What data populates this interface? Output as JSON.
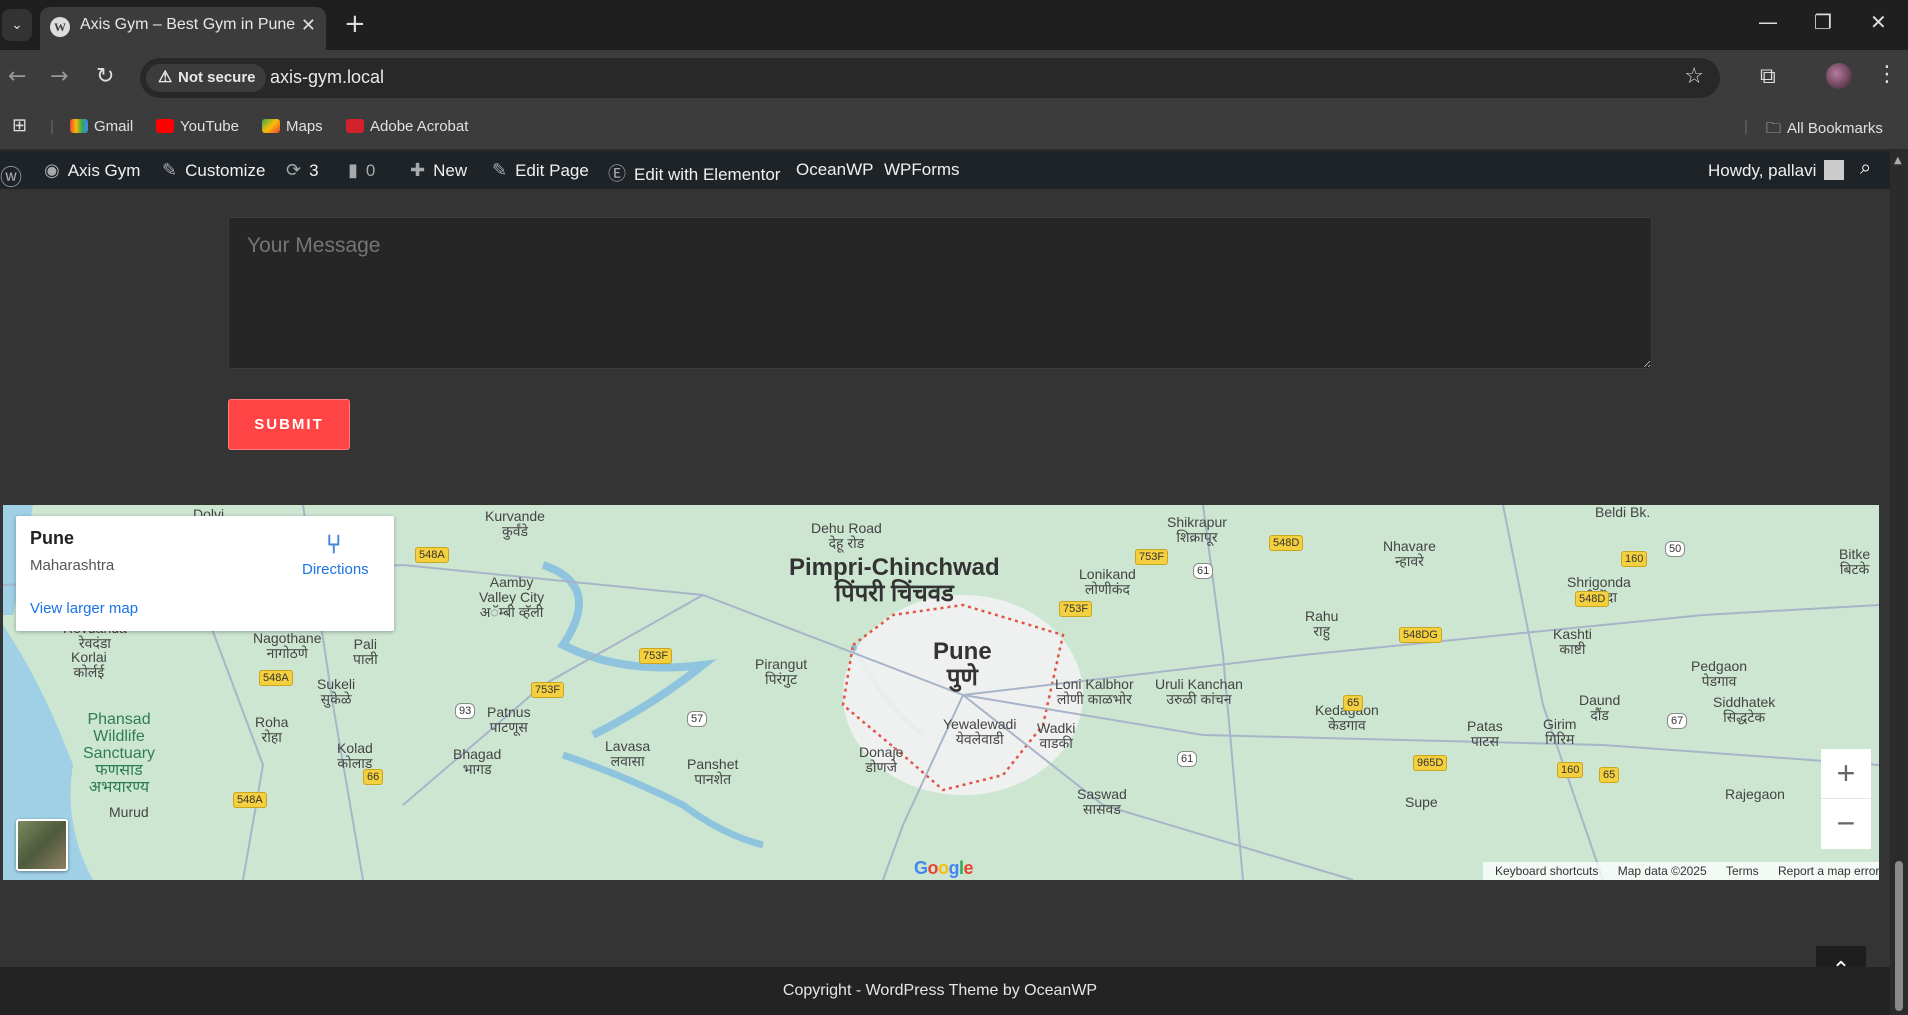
{
  "browser": {
    "tab_title": "Axis Gym – Best Gym in Pune",
    "security_label": "Not secure",
    "url": "axis-gym.local",
    "bookmarks": [
      "Gmail",
      "YouTube",
      "Maps",
      "Adobe Acrobat"
    ],
    "all_bookmarks": "All Bookmarks"
  },
  "adminbar": {
    "site_name": "Axis Gym",
    "customize": "Customize",
    "updates": "3",
    "comments": "0",
    "new": "New",
    "edit_page": "Edit Page",
    "edit_elementor": "Edit with Elementor",
    "oceanwp": "OceanWP",
    "wpforms": "WPForms",
    "howdy": "Howdy, pallavi"
  },
  "form": {
    "message_placeholder": "Your Message",
    "submit_label": "SUBMIT"
  },
  "map": {
    "place_name": "Pune",
    "place_region": "Maharashtra",
    "directions": "Directions",
    "view_larger": "View larger map",
    "labels": [
      "Dolvi",
      "Kurvande\nकुर्वंडे",
      "Dehu Road\nदेहू रोड",
      "Shikrapur\nशिक्रापूर",
      "Nhavare\nन्हावरे",
      "Beldi Bk.",
      "Aamby\nValley City\nअॅम्बी व्हॅली",
      "Lonikand\nलोणीकंद",
      "Rahu\nराहु",
      "Shrigonda\nश्रीगोंदा",
      "Bitke\nबिटके",
      "Revdanda\nरेवदंडा",
      "Korlai\nकोर्लई",
      "Nagothane\nनागोठणे",
      "Pali\nपाली",
      "Kashti\nकाष्टी",
      "Pirangut\nपिरंगुट",
      "Loni Kalbhor\nलोणी काळभोर",
      "Uruli Kanchan\nउरुळी कांचन",
      "Pedgaon\nपेडगाव",
      "Sukeli\nसुकेळे",
      "Patnus\nपाटणूस",
      "Daund\nदौंड",
      "Siddhatek\nसिद्धटेक",
      "Phansad\nWildlife\nSanctuary\nफणसाड\nअभयारण्य",
      "Roha\nरोहा",
      "Kedagaon\nकेडगाव",
      "Patas\nपाटस",
      "Girim\nगिरिम",
      "Yewalewadi\nयेवलेवाडी",
      "Wadki\nवाडकी",
      "Lavasa\nलवासा",
      "Kolad\nकोलाड",
      "Bhagad\nभागड",
      "Panshet\nपानशेत",
      "Donaje\nडोणजे",
      "Saswad\nसासवड",
      "Supe",
      "Rajegaon",
      "Murud"
    ],
    "city_major": "Pimpri-Chinchwad\nपिंपरी चिंचवड",
    "city_pune": "Pune\nपुणे",
    "shields": [
      "548A",
      "753F",
      "548D",
      "160",
      "50",
      "61",
      "753F",
      "548D",
      "548DG",
      "66",
      "753F",
      "548A",
      "753F",
      "93",
      "57",
      "65",
      "67",
      "965D",
      "61",
      "160",
      "65",
      "66",
      "548A"
    ],
    "google": "Google",
    "attribution": [
      "Keyboard shortcuts",
      "Map data ©2025",
      "Terms",
      "Report a map error"
    ]
  },
  "footer": {
    "copyright": "Copyright - WordPress Theme by OceanWP"
  },
  "colors": {
    "submit": "#fe4444",
    "adminbar": "#1d2327",
    "link": "#1a73e8"
  }
}
